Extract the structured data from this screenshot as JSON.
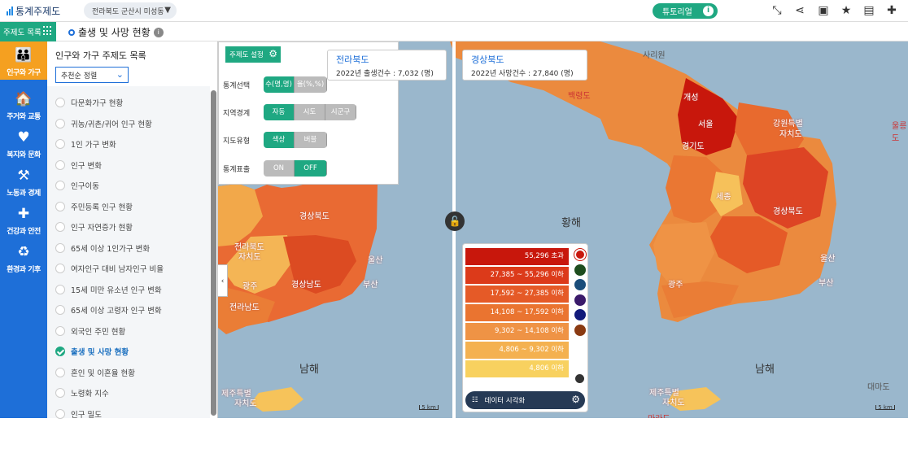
{
  "header": {
    "brand": "통계주제도",
    "region_select": "전라북도 군산시 미성동",
    "tutorial_label": "튜토리얼"
  },
  "subbar": {
    "menu_label": "주제도 목록",
    "page_title": "출생 및 사망 현황"
  },
  "leftnav": {
    "items": [
      {
        "label": "인구와 가구",
        "icon": "people-icon",
        "active": true
      },
      {
        "label": "주거와 교통",
        "icon": "house-car-icon"
      },
      {
        "label": "복지와 문화",
        "icon": "welfare-icon"
      },
      {
        "label": "노동과 경제",
        "icon": "worker-icon"
      },
      {
        "label": "건강과 안전",
        "icon": "health-icon"
      },
      {
        "label": "환경과 기후",
        "icon": "environment-icon"
      }
    ],
    "bottom_label": "목록"
  },
  "topic_panel": {
    "heading": "인구와 가구 주제도 목록",
    "sort_label": "추천순 정렬",
    "topics": [
      "다문화가구 현황",
      "귀농/귀촌/귀어 인구 현황",
      "1인 가구 변화",
      "인구 변화",
      "인구이동",
      "주민등록 인구 현황",
      "인구 자연증가 현황",
      "65세 이상 1인가구 변화",
      "여자인구 대비 남자인구 비율",
      "15세 미만 유소년 인구 변화",
      "65세 이상 고령자 인구 변화",
      "외국인 주민 현황",
      "출생 및 사망 현황",
      "혼인 및 이혼율 현황",
      "노령화 지수",
      "인구 밀도"
    ],
    "selected_index": 12
  },
  "settings": {
    "button_label": "주제도 설정",
    "rows": [
      {
        "label": "통계선택",
        "options": [
          "수(명,명)",
          "율(%,%)"
        ],
        "active": 0
      },
      {
        "label": "지역경계",
        "options": [
          "자동",
          "시도",
          "시군구"
        ],
        "active": 0
      },
      {
        "label": "지도유형",
        "options": [
          "색상",
          "버블"
        ],
        "active": 0
      },
      {
        "label": "통계표출",
        "options": [
          "ON",
          "OFF"
        ],
        "active": 1
      }
    ]
  },
  "left_infobox": {
    "region": "전라북도",
    "stat": "2022년 출생건수  :  7,032 (명)"
  },
  "right_infobox": {
    "region": "경상북도",
    "stat": "2022년 사망건수  :  27,840 (명)"
  },
  "legend": {
    "ranges": [
      {
        "label": "55,296 초과",
        "color": "#c8170c"
      },
      {
        "label": "27,385 ~ 55,296 이하",
        "color": "#dc3a1a"
      },
      {
        "label": "17,592 ~ 27,385 이하",
        "color": "#e55a27"
      },
      {
        "label": "14,108 ~ 17,592 이하",
        "color": "#ea7430"
      },
      {
        "label": "9,302 ~ 14,108 이하",
        "color": "#ef9345"
      },
      {
        "label": "4,806 ~ 9,302 이하",
        "color": "#f4b150"
      },
      {
        "label": "4,806 이하",
        "color": "#f8d15f"
      }
    ],
    "palette": [
      "#c8170c",
      "#1e4d1e",
      "#1a4d7a",
      "#3a1a6a",
      "#121a7a",
      "#8a3a12"
    ],
    "viz_button": "데이터 시각화"
  },
  "map_labels": {
    "left": [
      "경상북도",
      "전라북도",
      "자치도",
      "울산",
      "부산",
      "경상남도",
      "광주",
      "전라남도",
      "남해",
      "제주특별",
      "자치도"
    ],
    "right": [
      "사리원",
      "개성",
      "서울",
      "강원특별",
      "자치도",
      "경기도",
      "세종",
      "경상북도",
      "울산",
      "부산",
      "광주",
      "백령도",
      "울릉도",
      "황해",
      "남해",
      "제주특별",
      "자치도",
      "마라도",
      "대마도"
    ],
    "scale": "5 km"
  },
  "colors": {
    "accent": "#1fa882",
    "nav": "#1e6fd8",
    "active_nav": "#f5a020"
  }
}
